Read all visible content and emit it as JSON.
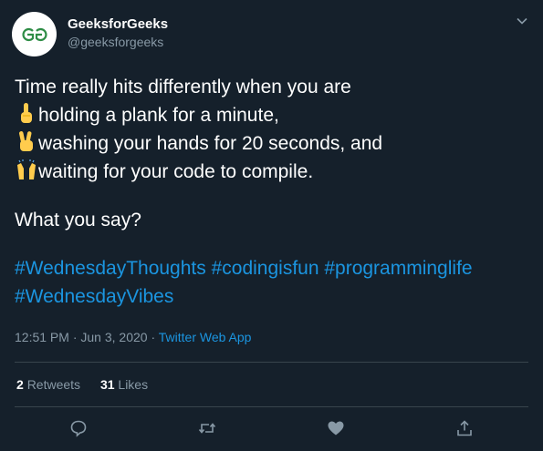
{
  "author": {
    "name": "GeeksforGeeks",
    "handle": "@geeksforgeeks",
    "avatar_text": "GG"
  },
  "tweet": {
    "line1": "Time really hits differently when you are",
    "line2": "holding a plank for a minute,",
    "line3": "washing your hands for 20 seconds, and",
    "line4": "waiting for your code to compile.",
    "line5": "What you say?",
    "hashtags_line1": "#WednesdayThoughts #codingisfun #programminglife",
    "hashtags_line2": "#WednesdayVibes"
  },
  "emojis": [
    "index-pointing-up",
    "victory-hand",
    "raising-hands"
  ],
  "meta": {
    "time": "12:51 PM",
    "separator": " · ",
    "date": "Jun 3, 2020",
    "source": "Twitter Web App"
  },
  "stats": {
    "retweets_count": "2",
    "retweets_label": "Retweets",
    "likes_count": "31",
    "likes_label": "Likes"
  },
  "actions": [
    "reply-icon",
    "retweet-icon",
    "like-icon",
    "share-icon"
  ],
  "colors": {
    "background": "#15202b",
    "text": "#ffffff",
    "secondary": "#8899a6",
    "link": "#1b95e0",
    "divider": "#38444d",
    "brand": "#2f8d46"
  }
}
